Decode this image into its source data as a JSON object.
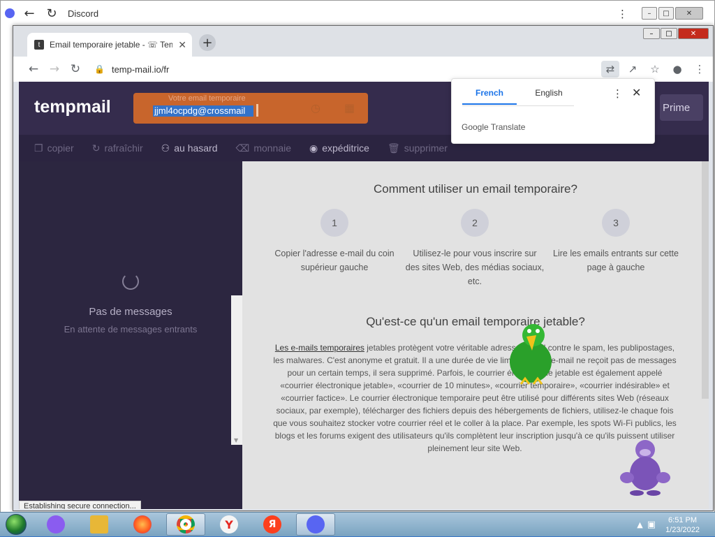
{
  "discord_window": {
    "title": "Discord"
  },
  "chrome": {
    "tab_title": "Email temporaire jetable - ☏ Tem",
    "url": "temp-mail.io/fr"
  },
  "site": {
    "brand": "tempmail",
    "email_label": "Votre email temporaire",
    "email_value": "jjml4ocpdg@crossmail",
    "prime_label": "Prime",
    "nav": [
      {
        "label": "copier"
      },
      {
        "label": "rafraîchir"
      },
      {
        "label": "au hasard"
      },
      {
        "label": "monnaie"
      },
      {
        "label": "expéditrice"
      },
      {
        "label": "supprimer"
      }
    ],
    "inbox": {
      "empty_title": "Pas de messages",
      "empty_sub": "En attente de messages entrants"
    },
    "status": "Establishing secure connection...",
    "how_title": "Comment utiliser un email temporaire?",
    "steps": [
      {
        "num": "1",
        "text": "Copier l'adresse e-mail du coin supérieur gauche"
      },
      {
        "num": "2",
        "text": "Utilisez-le pour vous inscrire sur des sites Web, des médias sociaux, etc."
      },
      {
        "num": "3",
        "text": "Lire les emails entrants sur cette page à gauche"
      }
    ],
    "what_title": "Qu'est-ce qu'un email temporaire jetable?",
    "para_link": "Les e-mails temporaires",
    "para_text": " jetables protègent votre véritable adresse e-mail contre le spam, les publipostages, les malwares. C'est anonyme et gratuit. Il a une durée de vie limitée: si cet e-mail ne reçoit pas de messages pour un certain temps, il sera supprimé. Parfois, le courrier électronique jetable est également appelé «courrier électronique jetable», «courrier de 10 minutes», «courrier temporaire», «courrier indésirable» et «courrier factice». Le courrier électronique temporaire peut être utilisé pour différents sites Web (réseaux sociaux, par exemple), télécharger des fichiers depuis des hébergements de fichiers, utilisez-le chaque fois que vous souhaitez stocker votre courrier réel et le coller à la place. Par exemple, les spots Wi-Fi publics, les blogs et les forums exigent des utilisateurs qu'ils complètent leur inscription jusqu'à ce qu'ils puissent utiliser pleinement leur site Web."
  },
  "translate_popup": {
    "tab_active": "French",
    "tab_other": "English",
    "brand": "Google Translate"
  },
  "taskbar": {
    "time": "6:51 PM",
    "date": "1/23/2022"
  },
  "colors": {
    "accent_orange": "#c8652c",
    "site_dark": "#352c4d",
    "discord": "#5865f2"
  }
}
